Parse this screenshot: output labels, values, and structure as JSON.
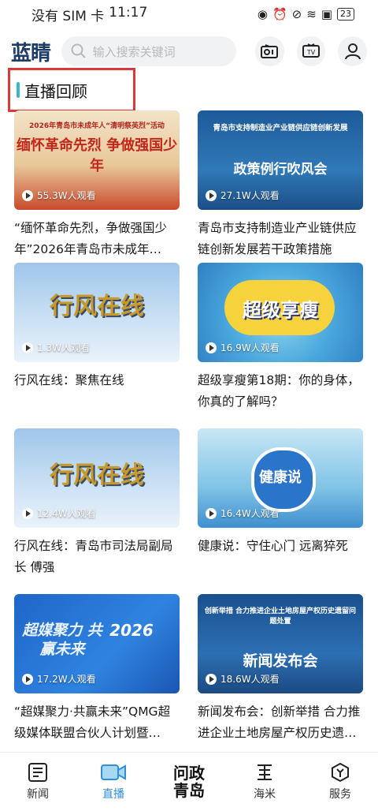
{
  "status_bar": {
    "carrier": "没有 SIM 卡",
    "time": "11:17",
    "battery": "23"
  },
  "header": {
    "logo": "蓝睛",
    "search_placeholder": "输入搜索关键词"
  },
  "section": {
    "title": "直播回顾"
  },
  "cards": [
    {
      "views": "55.3W人观看",
      "title": "“缅怀革命先烈，争做强国少年”2026年青岛市未成年…",
      "thumb_line1": "2026年青岛市未成年人“清明祭英烈”活动",
      "thumb_line2": "缅怀革命先烈 争做强国少年"
    },
    {
      "views": "27.1W人观看",
      "title": "青岛市支持制造业产业链供应链创新发展若干政策措施",
      "thumb_line1": "青岛市支持制造业产业链供应链创新发展",
      "thumb_line2": "政策例行吹风会"
    },
    {
      "views": "1.3W人观看",
      "title": "行风在线：聚焦在线",
      "thumb_line1": "行风在线",
      "thumb_line2": ""
    },
    {
      "views": "16.9W人观看",
      "title": "超级享瘦第18期：你的身体，你真的了解吗？",
      "thumb_line1": "超级享瘦",
      "thumb_line2": ""
    },
    {
      "views": "12.4W人观看",
      "title": "行风在线：青岛市司法局副局长 傅强",
      "thumb_line1": "行风在线",
      "thumb_line2": ""
    },
    {
      "views": "16.4W人观看",
      "title": "健康说：守住心门 远离猝死",
      "thumb_line1": "健康说",
      "thumb_line2": ""
    },
    {
      "views": "17.2W人观看",
      "title": "“超媒聚力·共赢未来”QMG超级媒体联盟合伙人计划暨…",
      "thumb_line1": "超媒聚力 共赢未来",
      "thumb_line2": "2026"
    },
    {
      "views": "18.6W人观看",
      "title": "新闻发布会：创新举措 合力推进企业土地房屋产权历史遗…",
      "thumb_line1": "创新举措 合力推进企业土地房屋产权历史遗留问题处置",
      "thumb_line2": "新闻发布会"
    }
  ],
  "tabbar": {
    "items": [
      {
        "label": "新闻",
        "icon": "news-icon"
      },
      {
        "label": "直播",
        "icon": "live-icon"
      },
      {
        "label": "问政\n青岛",
        "icon": "wenzheng-logo"
      },
      {
        "label": "海米",
        "icon": "haimi-icon"
      },
      {
        "label": "服务",
        "icon": "service-icon"
      }
    ],
    "active": "直播"
  },
  "colors": {
    "accent": "#2f8fd8",
    "highlight_box": "#d83a3a",
    "title_bar": "#39b7cf"
  }
}
